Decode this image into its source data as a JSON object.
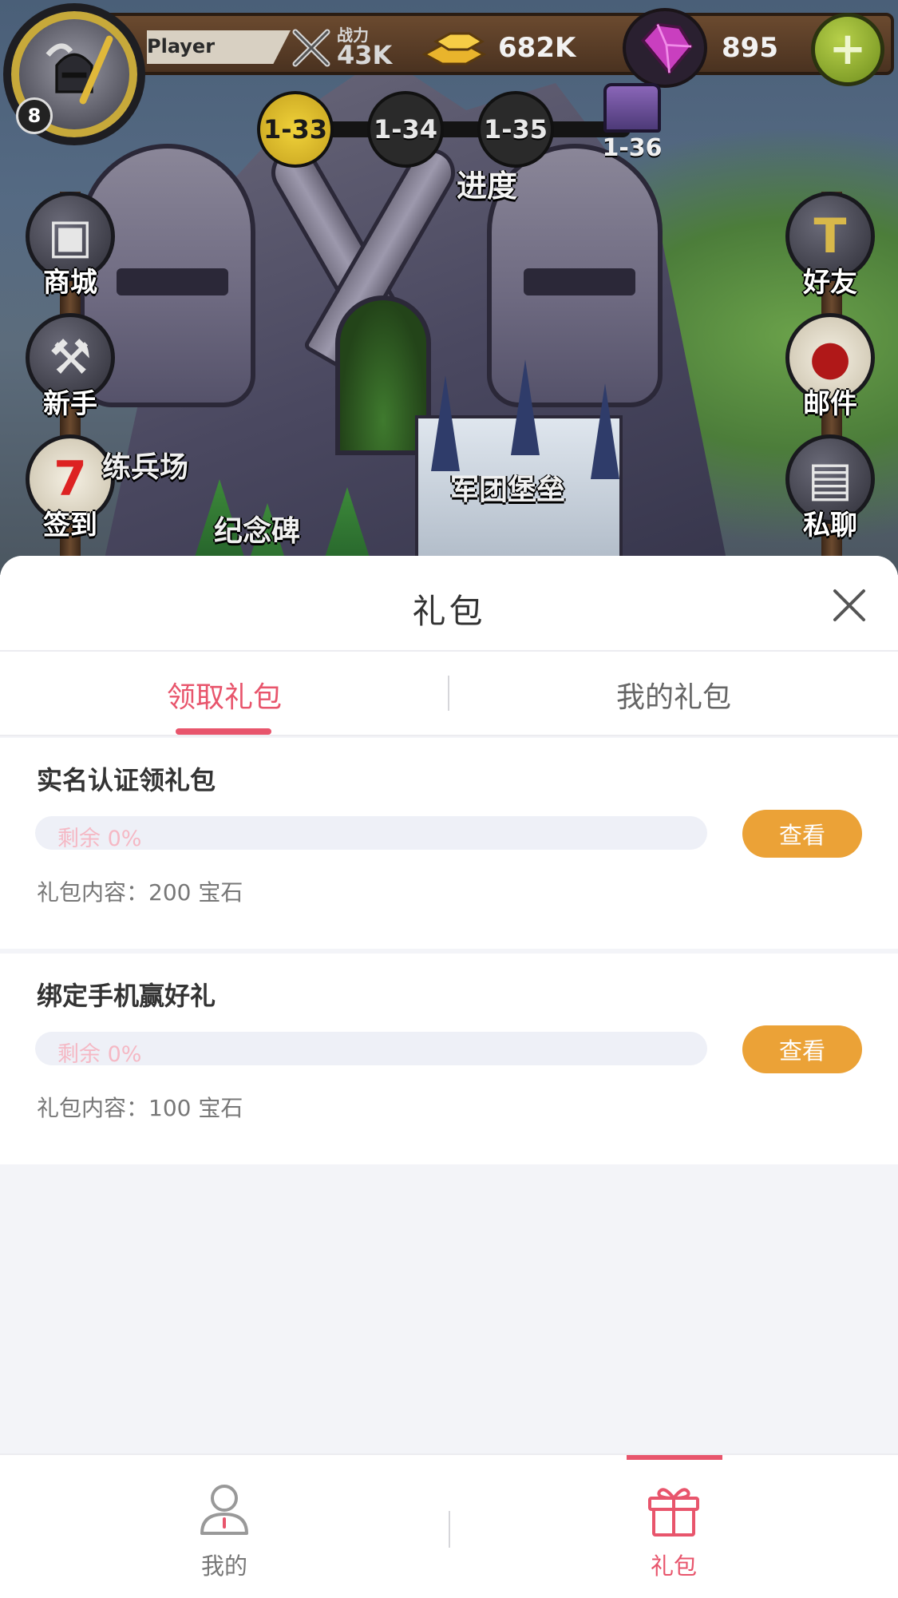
{
  "game": {
    "player_name": "Player",
    "level": "8",
    "power_label": "战力",
    "power_value": "43K",
    "gold": "682K",
    "gems": "895",
    "stages": [
      "1-33",
      "1-34",
      "1-35",
      "1-36"
    ],
    "stage_progress": 0.08,
    "progress_label": "进度",
    "left_buttons": [
      "商城",
      "新手",
      "签到"
    ],
    "right_buttons": [
      "好友",
      "邮件",
      "私聊"
    ],
    "map_labels": [
      "练兵场",
      "纪念碑",
      "军团堡垒"
    ]
  },
  "panel": {
    "title": "礼包",
    "tabs": [
      {
        "label": "领取礼包",
        "active": true
      },
      {
        "label": "我的礼包",
        "active": false
      }
    ],
    "gifts": [
      {
        "title": "实名认证领礼包",
        "remaining": "剩余 0%",
        "remaining_fraction": 0,
        "button": "查看",
        "content": "礼包内容：200 宝石"
      },
      {
        "title": "绑定手机赢好礼",
        "remaining": "剩余 0%",
        "remaining_fraction": 0,
        "button": "查看",
        "content": "礼包内容：100 宝石"
      }
    ]
  },
  "bottom_nav": {
    "items": [
      {
        "label": "我的",
        "icon": "user-icon",
        "active": false
      },
      {
        "label": "礼包",
        "icon": "gift-icon",
        "active": true
      }
    ]
  },
  "colors": {
    "accent": "#e8556c",
    "button": "#eba237",
    "progress_track": "#eef0f7",
    "background": "#f3f4f8"
  }
}
